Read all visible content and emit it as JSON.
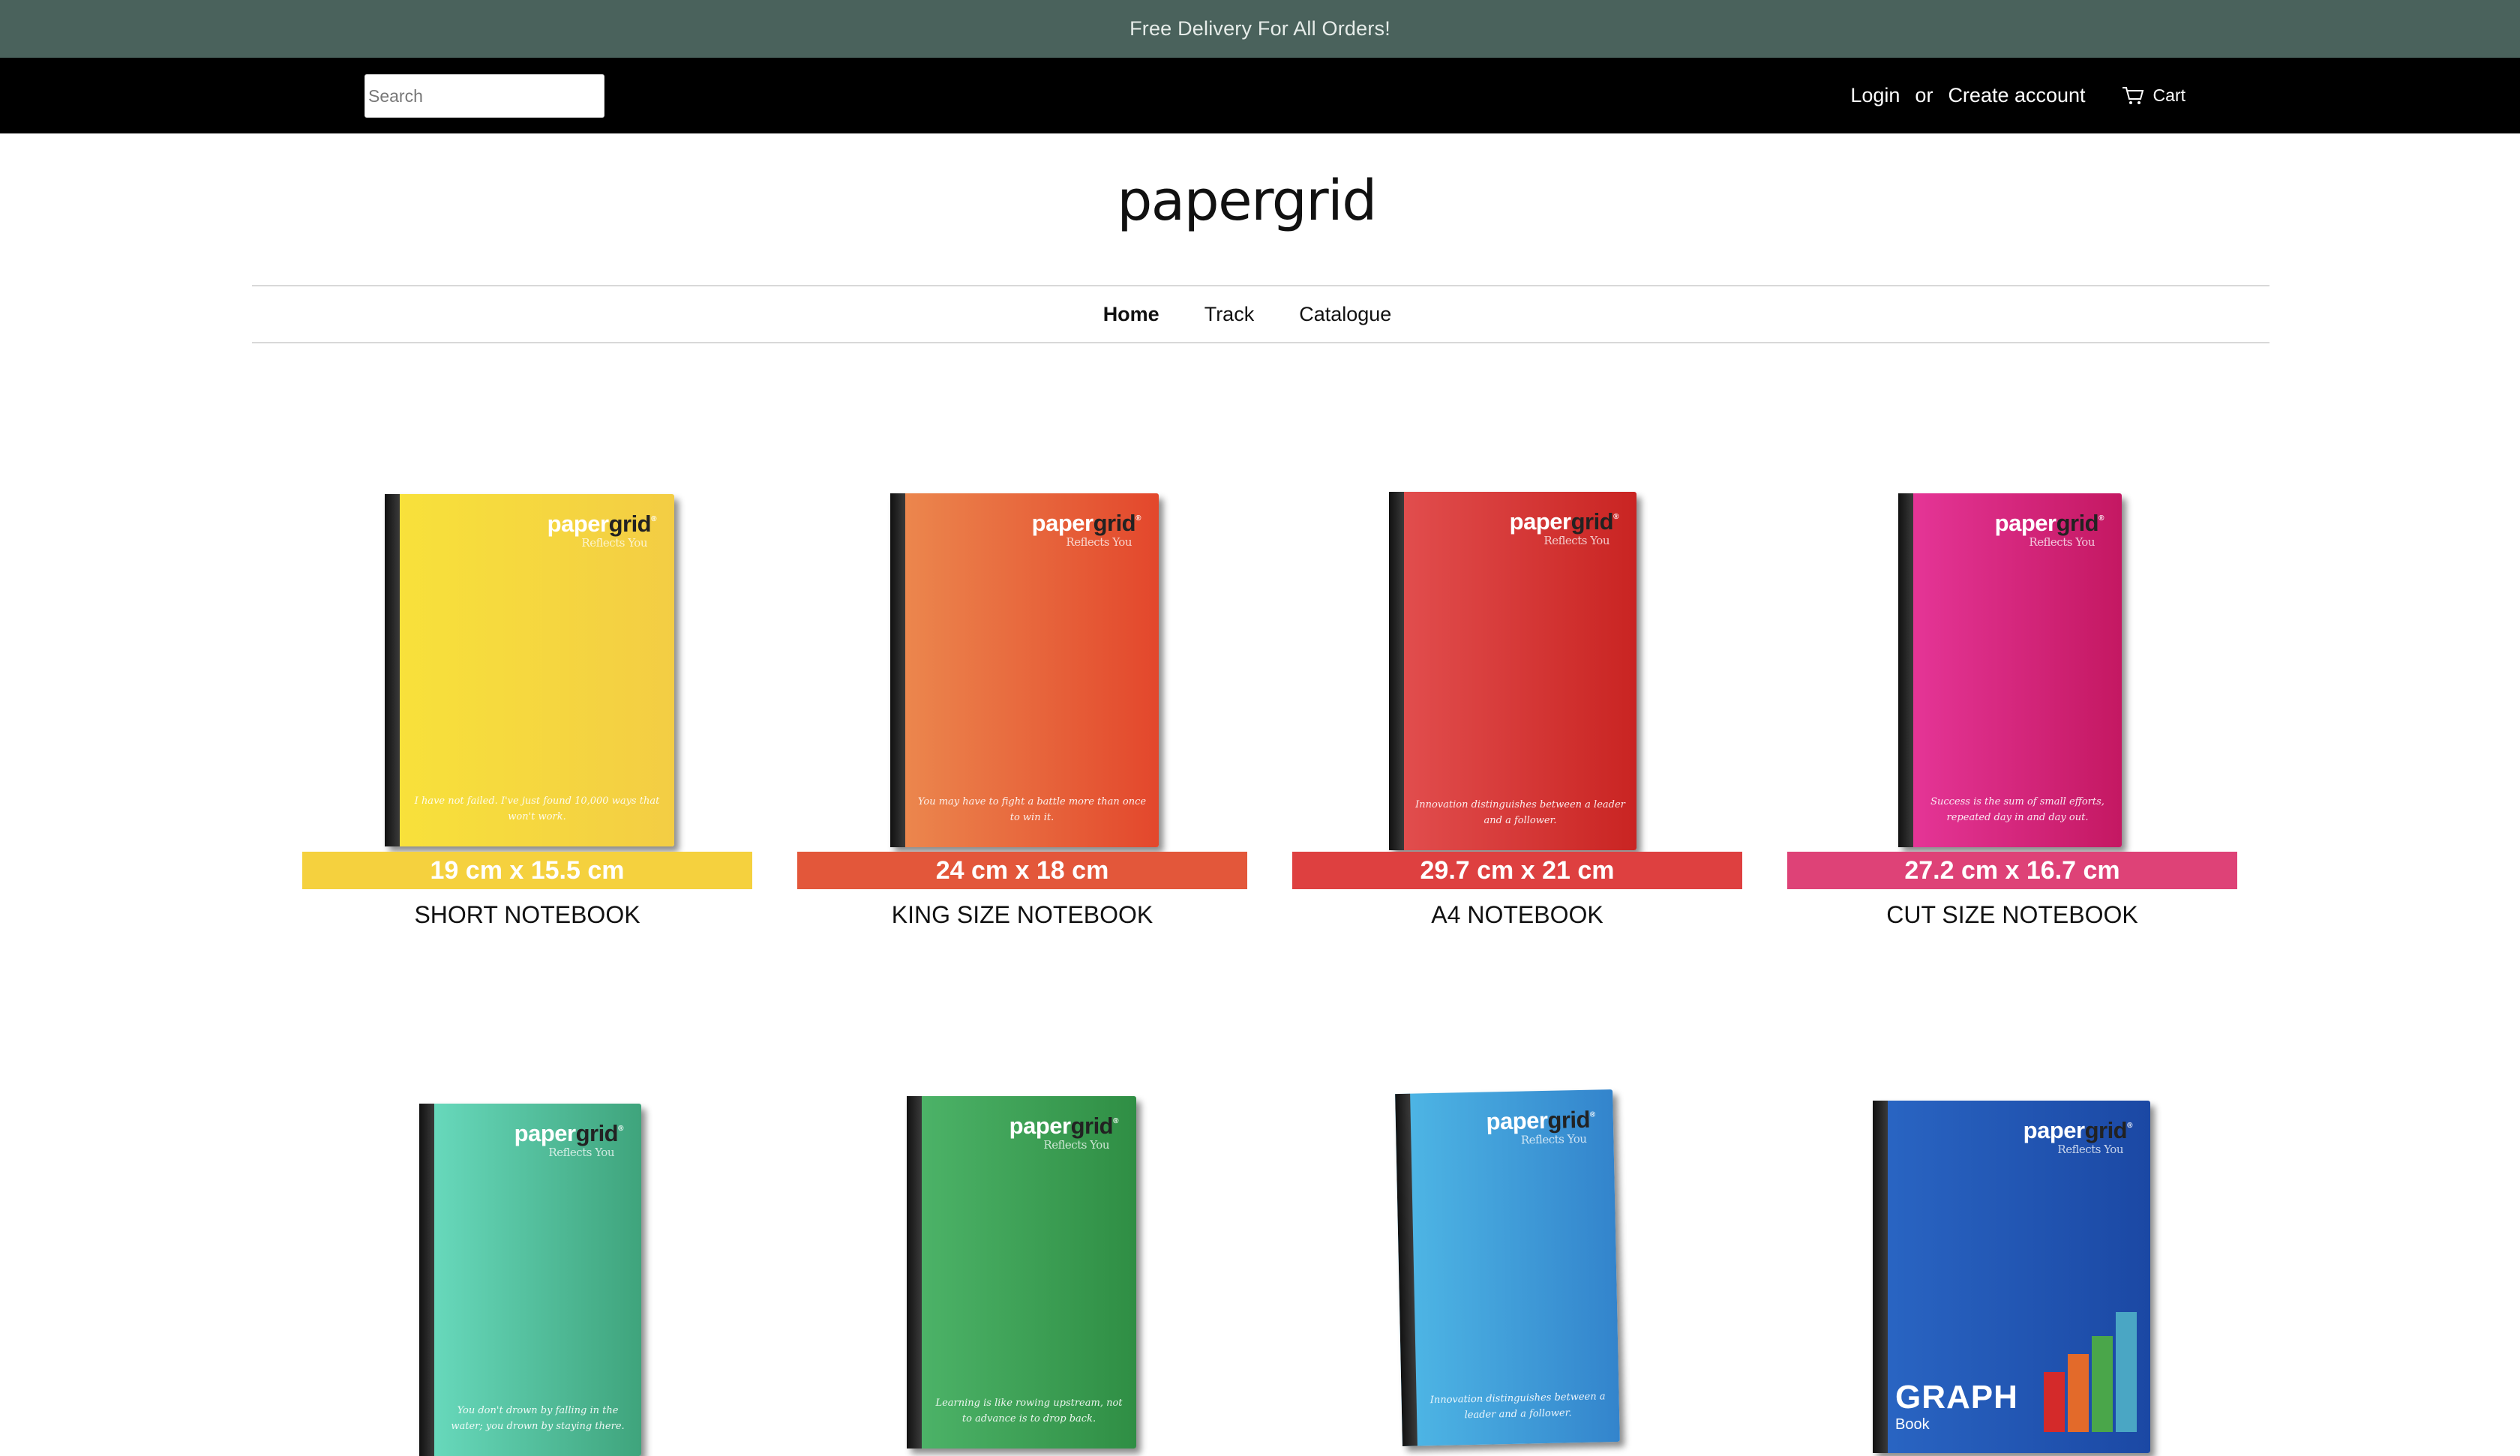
{
  "announcement": "Free Delivery For All Orders!",
  "header": {
    "search_placeholder": "Search",
    "login": "Login",
    "or": "or",
    "create_account": "Create account",
    "cart": "Cart"
  },
  "logo": "papergrid",
  "nav": {
    "items": [
      "Home",
      "Track",
      "Catalogue"
    ],
    "active": "Home"
  },
  "cover_brand": {
    "paper": "paper",
    "grid": "grid",
    "tagline": "Reflects You",
    "reg": "®"
  },
  "products": [
    {
      "size": "19 cm x 15.5 cm",
      "title": "SHORT NOTEBOOK",
      "size_color": "#f5d13e",
      "cover_color_a": "#f8e23a",
      "cover_color_b": "#f3cd44",
      "quote": "I have not failed. I've just found 10,000 ways that won't work."
    },
    {
      "size": "24 cm x 18 cm",
      "title": "KING SIZE NOTEBOOK",
      "size_color": "#e3573a",
      "cover_color_a": "#ec8a4f",
      "cover_color_b": "#e3472c",
      "quote": "You may have to fight a battle more than once to win it."
    },
    {
      "size": "29.7 cm x 21 cm",
      "title": "A4 NOTEBOOK",
      "size_color": "#de4040",
      "cover_color_a": "#e35050",
      "cover_color_b": "#c92422",
      "quote": "Innovation distinguishes between a leader and a follower."
    },
    {
      "size": "27.2 cm x 16.7 cm",
      "title": "CUT SIZE NOTEBOOK",
      "size_color": "#de4277",
      "cover_color_a": "#e7379a",
      "cover_color_b": "#c41862",
      "quote": "Success is the sum of small efforts, repeated day in and day out."
    },
    {
      "cover_color_a": "#6adcc0",
      "cover_color_b": "#3fa47c",
      "quote": "You don't drown by falling in the water; you drown by staying there."
    },
    {
      "cover_color_a": "#4eb56a",
      "cover_color_b": "#2f8e44",
      "quote": "Learning is like rowing upstream, not to advance is to drop back."
    },
    {
      "cover_color_a": "#4fb8e6",
      "cover_color_b": "#3384cc",
      "quote": "Innovation distinguishes between a leader and a follower."
    },
    {
      "cover_color_a": "#2a66c4",
      "cover_color_b": "#1b48a4",
      "graph_title": "GRAPH",
      "graph_sub": "Book"
    }
  ]
}
